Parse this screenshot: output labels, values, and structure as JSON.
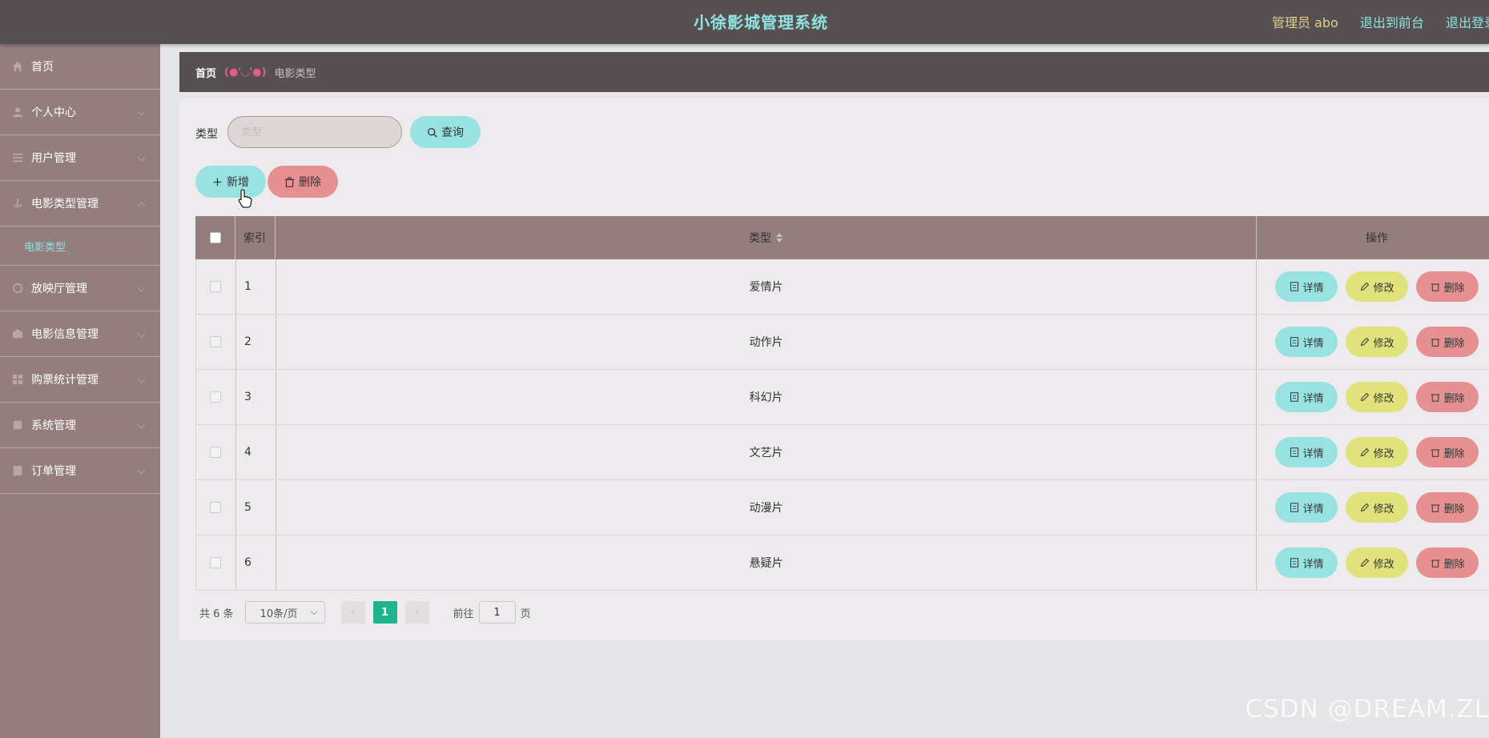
{
  "header": {
    "title": "小徐影城管理系统",
    "admin": "管理员 abo",
    "to_front": "退出到前台",
    "logout": "退出登录"
  },
  "sidebar": {
    "items": [
      {
        "label": "首页",
        "icon": "home-icon"
      },
      {
        "label": "个人中心",
        "icon": "user-icon"
      },
      {
        "label": "用户管理",
        "icon": "list-icon"
      },
      {
        "label": "电影类型管理",
        "icon": "anchor-icon"
      },
      {
        "label": "放映厅管理",
        "icon": "hall-icon"
      },
      {
        "label": "电影信息管理",
        "icon": "film-icon"
      },
      {
        "label": "购票统计管理",
        "icon": "grid-icon"
      },
      {
        "label": "系统管理",
        "icon": "settings-icon"
      },
      {
        "label": "订单管理",
        "icon": "order-icon"
      }
    ],
    "sub_item": "电影类型"
  },
  "breadcrumb": {
    "home": "首页",
    "separator": "(●'◡'●)",
    "current": "电影类型"
  },
  "search": {
    "label": "类型",
    "placeholder": "类型",
    "button": "查询"
  },
  "actions": {
    "add": "新增",
    "delete": "删除"
  },
  "table": {
    "headers": {
      "index": "索引",
      "type": "类型",
      "ops": "操作"
    },
    "rows": [
      {
        "index": "1",
        "type": "爱情片"
      },
      {
        "index": "2",
        "type": "动作片"
      },
      {
        "index": "3",
        "type": "科幻片"
      },
      {
        "index": "4",
        "type": "文艺片"
      },
      {
        "index": "5",
        "type": "动漫片"
      },
      {
        "index": "6",
        "type": "悬疑片"
      }
    ],
    "op_labels": {
      "detail": "详情",
      "edit": "修改",
      "delete": "删除"
    }
  },
  "pagination": {
    "total": "共 6 条",
    "page_size": "10条/页",
    "current_page": "1",
    "goto_prefix": "前往",
    "goto_value": "1",
    "goto_suffix": "页"
  },
  "watermark": "CSDN @DREAM.ZL",
  "colors": {
    "header_bg": "#565052",
    "sidebar_bg": "#947e7d",
    "accent_cyan": "#98e3e1",
    "accent_pink": "#e79092",
    "accent_yellow": "#e2e27d",
    "page_active": "#1fb38f"
  }
}
